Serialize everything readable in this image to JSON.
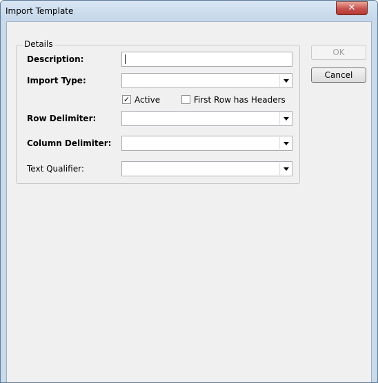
{
  "window": {
    "title": "Import Template",
    "close_glyph": "✕"
  },
  "details": {
    "legend": "Details",
    "description_label": "Description:",
    "description_value": "",
    "import_type_label": "Import Type:",
    "import_type_value": "",
    "active_label": "Active",
    "active_checked": true,
    "first_row_label": "First Row has Headers",
    "first_row_checked": false,
    "row_delimiter_label": "Row Delimiter:",
    "row_delimiter_value": "",
    "column_delimiter_label": "Column Delimiter:",
    "column_delimiter_value": "",
    "text_qualifier_label": "Text Qualifier:",
    "text_qualifier_value": ""
  },
  "buttons": {
    "ok": "OK",
    "cancel": "Cancel"
  },
  "icons": {
    "check_glyph": "✓",
    "unchecked_glyph": ""
  }
}
